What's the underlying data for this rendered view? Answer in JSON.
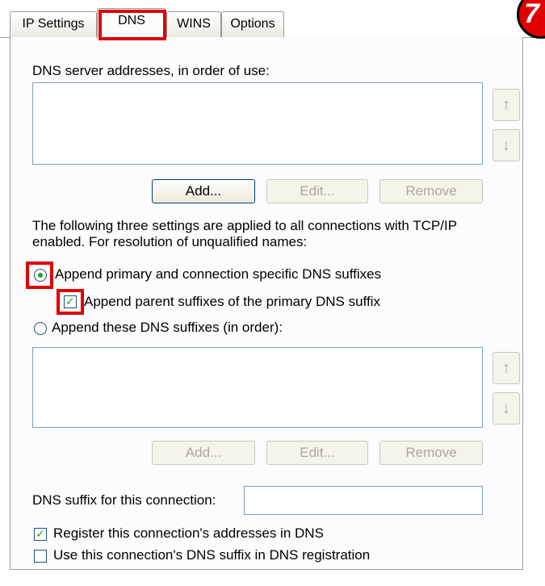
{
  "tabs": [
    {
      "label": "IP Settings"
    },
    {
      "label": "DNS"
    },
    {
      "label": "WINS"
    },
    {
      "label": "Options"
    }
  ],
  "step_badge": "7",
  "dns_servers": {
    "label": "DNS server addresses, in order of use:",
    "items": [],
    "add_label": "Add...",
    "edit_label": "Edit...",
    "remove_label": "Remove",
    "up_icon": "arrow-up-icon",
    "down_icon": "arrow-down-icon"
  },
  "info_text_line1": "The following three settings are applied to all connections with TCP/IP",
  "info_text_line2": "enabled. For resolution of unqualified names:",
  "radio_primary": {
    "label": "Append primary and connection specific DNS suffixes",
    "checked": true
  },
  "check_parent": {
    "label": "Append parent suffixes of the primary DNS suffix",
    "checked": true
  },
  "radio_these": {
    "label": "Append these DNS suffixes (in order):",
    "checked": false
  },
  "suffix_list": {
    "items": [],
    "add_label": "Add...",
    "edit_label": "Edit...",
    "remove_label": "Remove"
  },
  "dns_suffix": {
    "label": "DNS suffix for this connection:",
    "value": ""
  },
  "check_register": {
    "label": "Register this connection's addresses in DNS",
    "checked": true
  },
  "check_use_suffix": {
    "label": "Use this connection's DNS suffix in DNS registration",
    "checked": false
  },
  "colors": {
    "highlight": "#e00000",
    "check_green": "#21a121",
    "border": "#919b9c"
  }
}
